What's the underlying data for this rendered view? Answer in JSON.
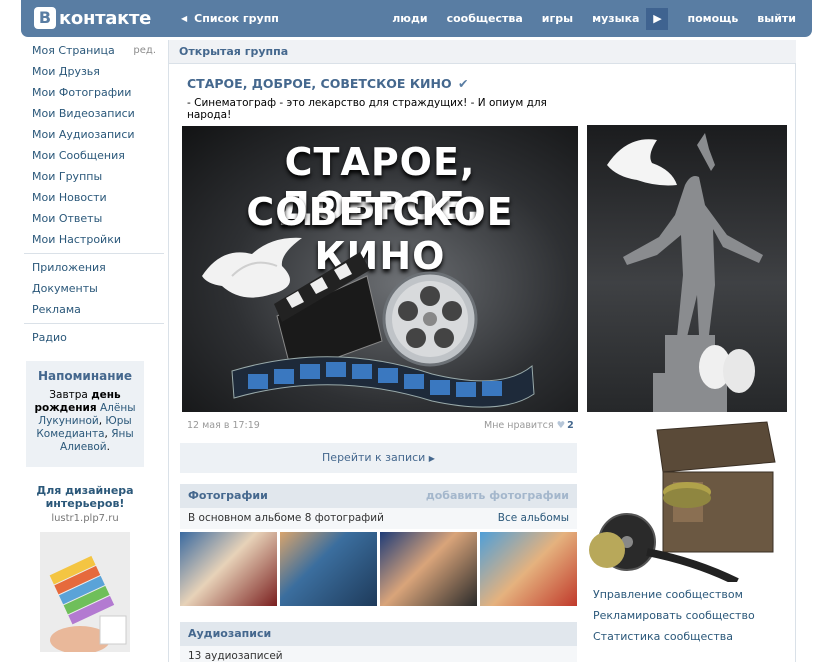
{
  "header": {
    "logo_text": "контакте",
    "back_label": "Список групп",
    "nav": [
      "люди",
      "сообщества",
      "игры",
      "музыка",
      "помощь",
      "выйти"
    ]
  },
  "left_menu": {
    "edit_label": "ред.",
    "group1": [
      "Моя Страница",
      "Мои Друзья",
      "Мои Фотографии",
      "Мои Видеозаписи",
      "Мои Аудиозаписи",
      "Мои Сообщения",
      "Мои Группы",
      "Мои Новости",
      "Мои Ответы",
      "Мои Настройки"
    ],
    "group2": [
      "Приложения",
      "Документы",
      "Реклама"
    ],
    "group3": [
      "Радио"
    ]
  },
  "reminder": {
    "title": "Напоминание",
    "text_1": "Завтра ",
    "text_bold": "день рождения",
    "text_2": " ",
    "link_1": "Алёны Лукуниной",
    "comma_1": ", ",
    "link_2": "Юры Комедианта",
    "comma_2": ", ",
    "link_3": "Яны Алиевой",
    "dot": "."
  },
  "ad": {
    "title": "Для дизайнера интерьеров!",
    "site": "lustr1.plp7.ru"
  },
  "group": {
    "type_label": "Открытая группа",
    "title": "СТАРОЕ, ДОБРОЕ, СОВЕТСКОЕ КИНО",
    "verified_mark": "✔",
    "status": "- Синематограф - это лекарство для страждущих! - И опиум для народа!"
  },
  "post": {
    "image_line1": "СТАРОЕ, ДОБРОЕ,",
    "image_line2": "СОВЕТСКОЕ КИНО",
    "date": "12 мая в 17:19",
    "likes_label": "Мне нравится",
    "likes_count": "2",
    "goto_label": "Перейти к записи"
  },
  "photos_section": {
    "title": "Фотографии",
    "action": "добавить фотографии",
    "subtitle": "В основном альбоме 8 фотографий",
    "all_label": "Все альбомы"
  },
  "audio_section": {
    "title": "Аудиозаписи",
    "subtitle": "13 аудиозаписей"
  },
  "right_links": [
    "Управление сообществом",
    "Рекламировать сообщество",
    "Статистика сообщества"
  ],
  "colors": {
    "header_bg": "#597da3",
    "link": "#2b587a",
    "section_head": "#e1e7ed"
  }
}
